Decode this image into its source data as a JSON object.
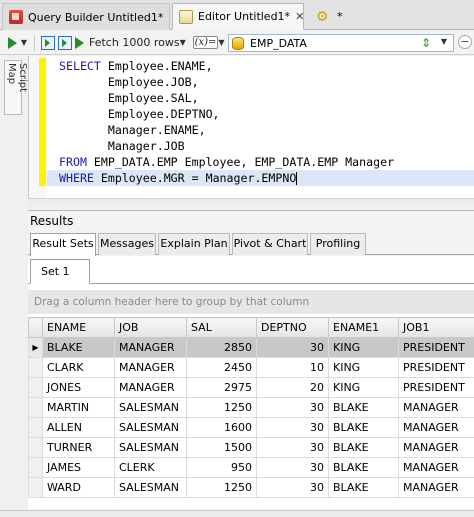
{
  "doc_tabs": [
    {
      "label": "Query Builder Untitled1*",
      "active": false
    },
    {
      "label": "Editor Untitled1*",
      "active": true
    },
    {
      "label": "*",
      "active": false
    }
  ],
  "toolbar": {
    "fetch_label": "Fetch 1000 rows",
    "var_label": "(x)=",
    "connection": "EMP_DATA"
  },
  "script_map_label": "Script Map",
  "sql_lines": [
    {
      "kw": "SELECT",
      "text": " Employee.ENAME,"
    },
    {
      "kw": "",
      "text": "       Employee.JOB,"
    },
    {
      "kw": "",
      "text": "       Employee.SAL,"
    },
    {
      "kw": "",
      "text": "       Employee.DEPTNO,"
    },
    {
      "kw": "",
      "text": "       Manager.ENAME,"
    },
    {
      "kw": "",
      "text": "       Manager.JOB"
    },
    {
      "kw": "FROM",
      "text": " EMP_DATA.EMP Employee, EMP_DATA.EMP Manager"
    },
    {
      "kw": "WHERE",
      "text": " Employee.MGR = Manager.EMPNO"
    }
  ],
  "results": {
    "title": "Results",
    "tabs": [
      "Result Sets",
      "Messages",
      "Explain Plan",
      "Pivot & Chart",
      "Profiling"
    ],
    "set_tab": "Set 1",
    "group_hint": "Drag a column header here to group by that column",
    "columns": [
      "ENAME",
      "JOB",
      "SAL",
      "DEPTNO",
      "ENAME1",
      "JOB1"
    ],
    "rows": [
      [
        "BLAKE",
        "MANAGER",
        "2850",
        "30",
        "KING",
        "PRESIDENT"
      ],
      [
        "CLARK",
        "MANAGER",
        "2450",
        "10",
        "KING",
        "PRESIDENT"
      ],
      [
        "JONES",
        "MANAGER",
        "2975",
        "20",
        "KING",
        "PRESIDENT"
      ],
      [
        "MARTIN",
        "SALESMAN",
        "1250",
        "30",
        "BLAKE",
        "MANAGER"
      ],
      [
        "ALLEN",
        "SALESMAN",
        "1600",
        "30",
        "BLAKE",
        "MANAGER"
      ],
      [
        "TURNER",
        "SALESMAN",
        "1500",
        "30",
        "BLAKE",
        "MANAGER"
      ],
      [
        "JAMES",
        "CLERK",
        "950",
        "30",
        "BLAKE",
        "MANAGER"
      ],
      [
        "WARD",
        "SALESMAN",
        "1250",
        "30",
        "BLAKE",
        "MANAGER"
      ]
    ]
  }
}
